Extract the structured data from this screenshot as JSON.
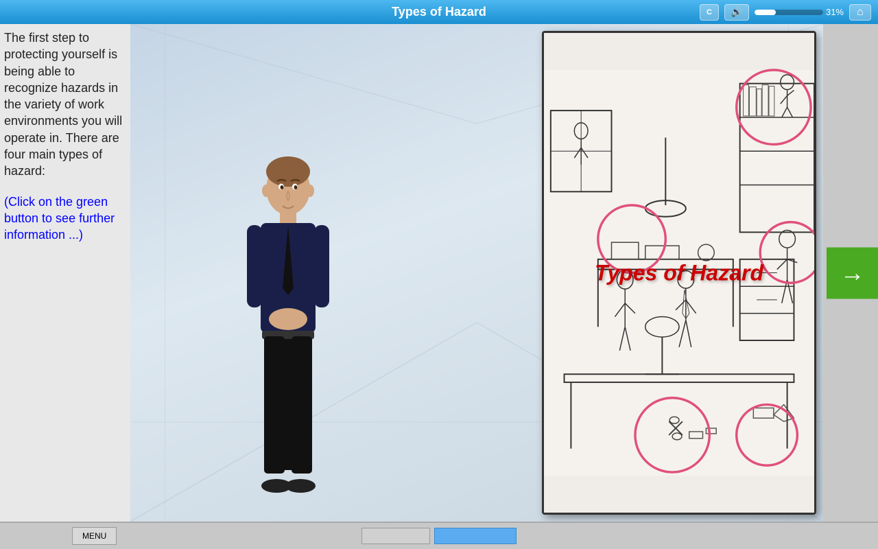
{
  "header": {
    "title": "Types of Hazard",
    "progress_percent": 31,
    "progress_label": "31%",
    "progress_bar_width": 31
  },
  "left_panel": {
    "main_text": "The first step to protecting yourself is being able to recognize hazards in the variety of work environments you will operate in. There are four main types of hazard:",
    "click_hint": "(Click on the green button to see further information ...)"
  },
  "hazard_image": {
    "title_overlay": "Types of Hazard"
  },
  "buttons": {
    "menu_label": "MENU",
    "next_arrow": "→"
  },
  "bottom_nav": {
    "btn1": "",
    "btn2": "",
    "btn3": ""
  },
  "icons": {
    "back_icon": "◀",
    "sound_icon": "🔊",
    "home_icon": "⌂",
    "caption_icon": "C"
  }
}
